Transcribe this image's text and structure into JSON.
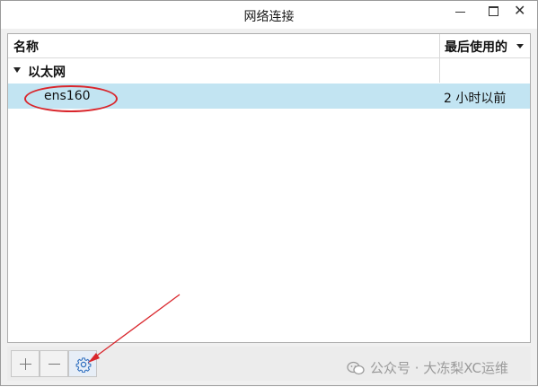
{
  "window": {
    "title": "网络连接"
  },
  "list": {
    "columns": {
      "name": "名称",
      "last_used": "最后使用的"
    },
    "group": {
      "label": "以太网"
    },
    "connection": {
      "name": "ens160",
      "last_used": "2 小时以前"
    }
  },
  "watermark": {
    "text": "公众号 · 大冻梨XC运维"
  },
  "colors": {
    "selected_row": "#c2e4f2",
    "annotation_red": "#d9262c",
    "settings_icon_blue": "#2f6fbf"
  }
}
